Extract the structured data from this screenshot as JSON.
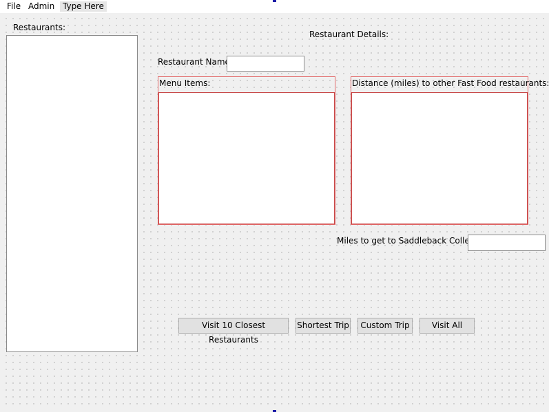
{
  "menubar": {
    "items": [
      {
        "label": "File"
      },
      {
        "label": "Admin"
      },
      {
        "label": "Type Here"
      }
    ]
  },
  "restaurants": {
    "label": "Restaurants:",
    "items": []
  },
  "details": {
    "heading": "Restaurant Details:",
    "name_label": "Restaurant Name",
    "name_value": ""
  },
  "menu_items": {
    "label": "Menu Items:",
    "items": []
  },
  "distances": {
    "label": "Distance (miles) to other Fast Food restaurants:",
    "items": []
  },
  "saddleback": {
    "label": "Miles to get to Saddleback College:",
    "value": ""
  },
  "buttons": {
    "visit_closest": "Visit 10 Closest Restaurants",
    "shortest_trip": "Shortest Trip",
    "custom_trip": "Custom Trip",
    "visit_all": "Visit All"
  }
}
